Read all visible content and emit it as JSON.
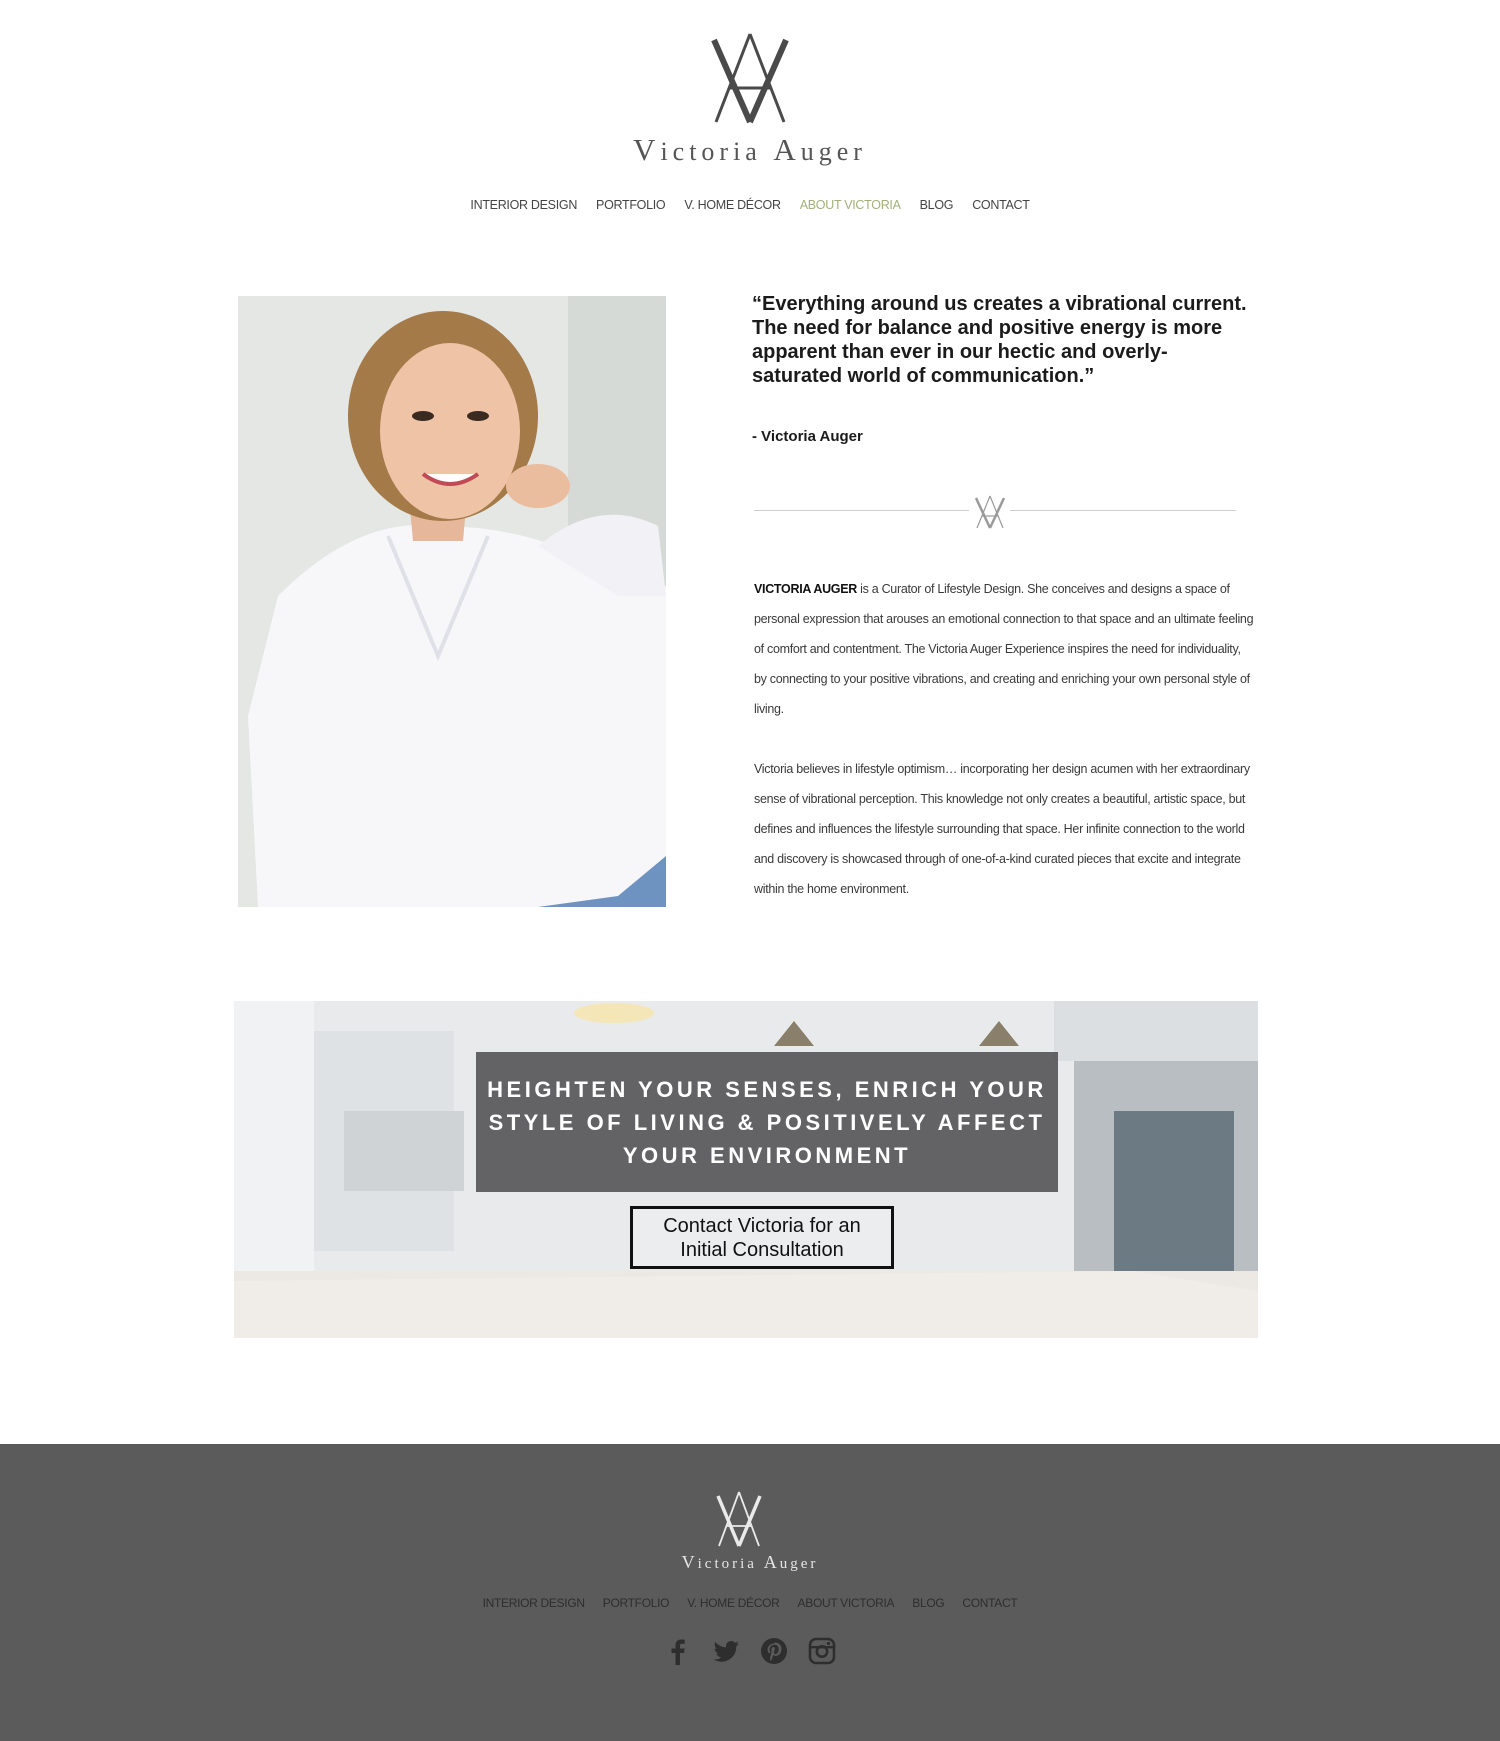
{
  "brand": {
    "first": "ictoria",
    "first_cap": "V",
    "last": "uger",
    "last_cap": "A"
  },
  "nav": [
    {
      "label": "INTERIOR DESIGN"
    },
    {
      "label": "PORTFOLIO"
    },
    {
      "label": "V. HOME DÉCOR"
    },
    {
      "label": "ABOUT VICTORIA",
      "active": true
    },
    {
      "label": "BLOG"
    },
    {
      "label": "CONTACT"
    }
  ],
  "about": {
    "quote": "“Everything around us creates a vibrational current. The need for balance and positive energy is more apparent than ever in our hectic and overly-saturated world of communication.”",
    "attribution": "- Victoria Auger",
    "bio1_name": "VICTORIA AUGER",
    "bio1_text": " is a Curator of Lifestyle Design. She conceives and designs a space of personal expression that arouses an emotional connection to that space and an ultimate feeling of comfort and contentment. The Victoria Auger Experience inspires the need for individuality, by connecting to your positive vibrations, and creating and enriching your own personal style of living.",
    "bio2_text": "Victoria believes in lifestyle optimism… incorporating her design acumen with her extraordinary sense of vibrational perception. This knowledge not only creates a beautiful, artistic space, but defines and influences the lifestyle surrounding that space.  Her infinite connection to the world and discovery is showcased through of one-of-a-kind curated pieces that excite and integrate within the home environment."
  },
  "banner": {
    "headline": "HEIGHTEN YOUR SENSES, ENRICH YOUR STYLE OF LIVING & POSITIVELY AFFECT YOUR ENVIRONMENT",
    "cta": "Contact Victoria for an Initial Consultation"
  },
  "footer": {
    "nav": [
      {
        "label": "INTERIOR DESIGN"
      },
      {
        "label": "PORTFOLIO"
      },
      {
        "label": "V. HOME DÉCOR"
      },
      {
        "label": "ABOUT VICTORIA"
      },
      {
        "label": "BLOG"
      },
      {
        "label": "CONTACT"
      }
    ],
    "social": [
      "facebook-icon",
      "twitter-icon",
      "pinterest-icon",
      "instagram-icon"
    ]
  },
  "colors": {
    "accent": "#a3b07a",
    "footer_bg": "#5b5b5b",
    "overlay": "#505052"
  }
}
